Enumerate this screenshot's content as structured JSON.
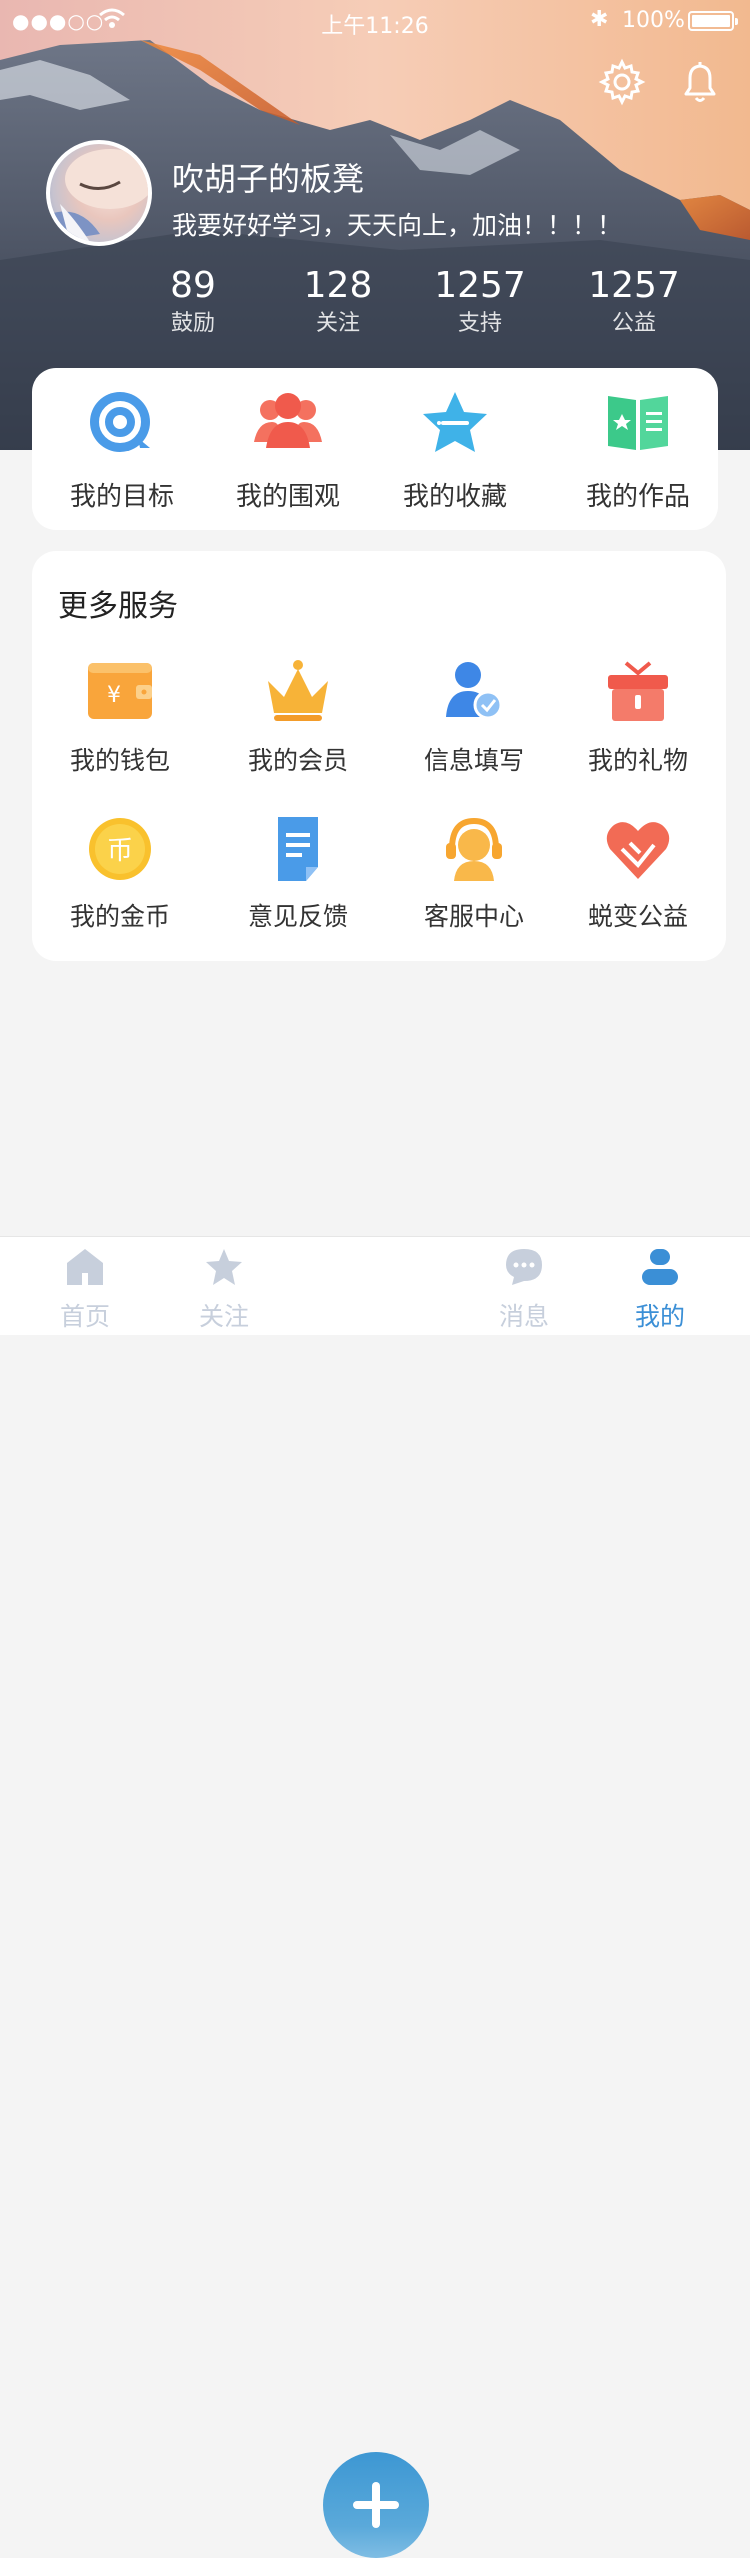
{
  "status_bar": {
    "signal": "●●●○○",
    "time": "上午11:26",
    "bluetooth": "✱",
    "battery": "100%"
  },
  "profile": {
    "name": "吹胡子的板凳",
    "motto": "我要好好学习，天天向上，加油！！！！"
  },
  "stats": [
    {
      "value": "89",
      "label": "鼓励"
    },
    {
      "value": "128",
      "label": "关注"
    },
    {
      "value": "1257",
      "label": "支持"
    },
    {
      "value": "1257",
      "label": "公益"
    }
  ],
  "quick_actions": [
    {
      "label": "我的目标",
      "icon": "target-icon"
    },
    {
      "label": "我的围观",
      "icon": "people-icon"
    },
    {
      "label": "我的收藏",
      "icon": "star-icon"
    },
    {
      "label": "我的作品",
      "icon": "book-icon"
    }
  ],
  "more_services": {
    "title": "更多服务",
    "items": [
      {
        "label": "我的钱包",
        "icon": "wallet-icon"
      },
      {
        "label": "我的会员",
        "icon": "crown-icon"
      },
      {
        "label": "信息填写",
        "icon": "user-check-icon"
      },
      {
        "label": "我的礼物",
        "icon": "gift-icon"
      },
      {
        "label": "我的金币",
        "icon": "coin-icon"
      },
      {
        "label": "意见反馈",
        "icon": "feedback-icon"
      },
      {
        "label": "客服中心",
        "icon": "headset-icon"
      },
      {
        "label": "蜕变公益",
        "icon": "heart-hands-icon"
      }
    ]
  },
  "icon_glyphs": {
    "wallet": "¥",
    "coin": "币"
  },
  "tabbar": [
    {
      "label": "首页",
      "icon": "home-icon"
    },
    {
      "label": "关注",
      "icon": "star-icon"
    },
    {
      "label": "消息",
      "icon": "chat-icon"
    },
    {
      "label": "我的",
      "icon": "user-icon",
      "active": true
    }
  ],
  "colors": {
    "accent": "#3b8fd6",
    "tab_inactive": "#c7cfdc"
  }
}
